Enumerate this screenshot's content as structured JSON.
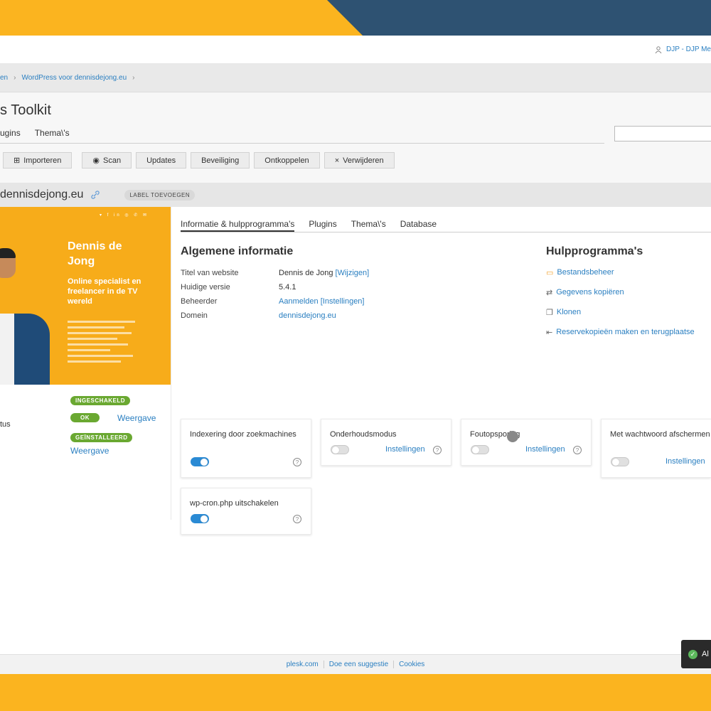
{
  "header": {
    "user_label": "DJP - DJP Me"
  },
  "breadcrumb": {
    "items": [
      "en",
      "WordPress voor dennisdejong.eu"
    ]
  },
  "page": {
    "title": "s Toolkit"
  },
  "top_tabs": [
    "ugins",
    "Thema\\'s"
  ],
  "search": {
    "placeholder": ""
  },
  "toolbar": {
    "import_label": "Importeren",
    "scan_label": "Scan",
    "updates_label": "Updates",
    "security_label": "Beveiliging",
    "disconnect_label": "Ontkoppelen",
    "delete_label": "Verwijderen"
  },
  "site": {
    "name": "dennisdejong.eu",
    "label_add": "LABEL TOEVOEGEN"
  },
  "preview": {
    "name": "Dennis de Jong",
    "tagline": "Online specialist en freelancer in de TV wereld",
    "social_icons": [
      "twitter-icon",
      "facebook-icon",
      "linkedin-icon",
      "instagram-icon",
      "phone-icon",
      "mail-icon"
    ]
  },
  "status": {
    "badge_enabled": "INGESCHAKELD",
    "status_label": "tus",
    "badge_ok": "OK",
    "view_link_1": "Weergave",
    "badge_installed": "GEÏNSTALLEERD",
    "view_link_2": "Weergave"
  },
  "sub_tabs": [
    "Informatie & hulpprogramma's",
    "Plugins",
    "Thema\\'s",
    "Database"
  ],
  "general_info": {
    "heading": "Algemene informatie",
    "title_key": "Titel van website",
    "title_val": "Dennis de Jong",
    "title_edit": "[Wijzigen]",
    "version_key": "Huidige versie",
    "version_val": "5.4.1",
    "admin_key": "Beheerder",
    "admin_login": "Aanmelden",
    "admin_settings": "[Instellingen]",
    "domain_key": "Domein",
    "domain_val": "dennisdejong.eu"
  },
  "tools": {
    "heading": "Hulpprogramma's",
    "file_manager": "Bestandsbeheer",
    "copy_data": "Gegevens kopiëren",
    "clone": "Klonen",
    "backup": "Reservekopieën maken en terugplaatse"
  },
  "cards": {
    "indexing": "Indexering door zoekmachines",
    "maintenance": "Onderhoudsmodus",
    "debug": "Foutopsporing",
    "password": "Met wachtwoord afschermen",
    "cron": "wp-cron.php uitschakelen",
    "settings_label": "Instellingen",
    "help_glyph": "?"
  },
  "toggles": {
    "indexing": true,
    "maintenance": false,
    "debug": false,
    "password": false,
    "cron": true
  },
  "footer": {
    "link1": "plesk.com",
    "link2": "Doe een suggestie",
    "link3": "Cookies"
  },
  "toast": {
    "text": "Al"
  },
  "colors": {
    "brand_orange": "#fbb41f",
    "navy": "#2e5272",
    "link_blue": "#2a7fc1",
    "badge_green": "#6aa831",
    "toggle_on": "#2a8ad4"
  }
}
